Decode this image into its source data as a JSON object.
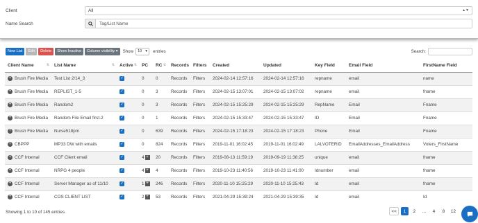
{
  "filters": {
    "client_label": "Client",
    "client_value": "All",
    "name_search_label": "Name Search",
    "name_search_placeholder": "Tag/List Name"
  },
  "toolbar": {
    "new_list": "New List",
    "edit": "Edit",
    "delete": "Delete",
    "show_inactive": "Show Inactive",
    "column_visibility": "Column visibility",
    "show_label": "Show",
    "page_length": "10",
    "entries_label": "entries",
    "search_label": "Search:"
  },
  "table": {
    "columns": [
      "Client Name",
      "List Name",
      "Active",
      "PC",
      "RC",
      "Records",
      "Filters",
      "Created",
      "Updated",
      "Key Field",
      "Email Field",
      "FirstName Field"
    ],
    "rows": [
      {
        "client": "Brush Fire Media",
        "list": "Test List 2/14_3",
        "pc": "0",
        "rc": "0",
        "records": "Records",
        "filters": "Filters",
        "created": "2024-02-14 12:57:16",
        "updated": "2024-02-14 12:57:16",
        "key": "repname",
        "email": "email",
        "first": "name"
      },
      {
        "client": "Brush Fire Media",
        "list": "REPLIST_1-5",
        "pc": "0",
        "rc": "3",
        "records": "Records",
        "filters": "Filters",
        "created": "2024-02-15 13:07:01",
        "updated": "2024-02-15 13:07:02",
        "key": "repname",
        "email": "email",
        "first": "fname"
      },
      {
        "client": "Brush Fire Media",
        "list": "Random2",
        "pc": "0",
        "rc": "3",
        "records": "Records",
        "filters": "Filters",
        "created": "2024-02-15 15:25:29",
        "updated": "2024-02-15 15:25:29",
        "key": "RepName",
        "email": "Email",
        "first": "Fname"
      },
      {
        "client": "Brush Fire Media",
        "list": "Random File Email first-2",
        "pc": "0",
        "rc": "1",
        "records": "Records",
        "filters": "Filters",
        "created": "2024-02-15 15:33:47",
        "updated": "2024-02-15 15:33:47",
        "key": "ID",
        "email": "Email",
        "first": "Fname"
      },
      {
        "client": "Brush Fire Media",
        "list": "Nurse518pm",
        "pc": "0",
        "rc": "639",
        "records": "Records",
        "filters": "Filters",
        "created": "2024-02-15 17:18:23",
        "updated": "2024-02-15 17:18:23",
        "key": "Phone",
        "email": "Email",
        "first": "Fname"
      },
      {
        "client": "CBPPP",
        "list": "MP33 DW with emails",
        "pc": "0",
        "rc": "824",
        "records": "Records",
        "filters": "Filters",
        "created": "2019-11-01 16:02:45",
        "updated": "2019-11-01 16:02:49",
        "key": "LALVOTERID",
        "email": "EmailAddresses_EmailAddress",
        "first": "Voters_FirstName"
      },
      {
        "client": "CCF Internal",
        "list": "CCF Client email",
        "pc": "4",
        "rc": "20",
        "records": "Records",
        "filters": "Filters",
        "created": "2019-08-13 11:59:19",
        "updated": "2019-09-19 11:38:25",
        "key": "unique",
        "email": "email",
        "first": "fname"
      },
      {
        "client": "CCF Internal",
        "list": "NRPG 4 people",
        "pc": "4",
        "rc": "4",
        "records": "Records",
        "filters": "Filters",
        "created": "2019-10-23 11:40:56",
        "updated": "2019-10-23 11:41:00",
        "key": "Idnumber",
        "email": "email",
        "first": "fname"
      },
      {
        "client": "CCF Internal",
        "list": "Server Manager as of 11/10",
        "pc": "1",
        "rc": "246",
        "records": "Records",
        "filters": "Filters",
        "created": "2020-11-10 15:25:29",
        "updated": "2020-11-10 15:25:43",
        "key": "Id",
        "email": "email",
        "first": "fname"
      },
      {
        "client": "CCF Internal",
        "list": "COS CLIENT LIST",
        "pc": "2",
        "rc": "53",
        "records": "Records",
        "filters": "Filters",
        "created": "2021-04-29 15:39:24",
        "updated": "2021-04-29 15:39:35",
        "key": "Id",
        "email": "email",
        "first": "Id"
      }
    ]
  },
  "footer": {
    "info": "Showing 1 to 10 of 145 entries",
    "pages": [
      "<<",
      "1",
      "2",
      "...",
      "4",
      "8",
      "12"
    ]
  },
  "colors": {
    "primary": "#1a6fc4",
    "danger": "#d9534f",
    "secondary": "#6c757d"
  }
}
